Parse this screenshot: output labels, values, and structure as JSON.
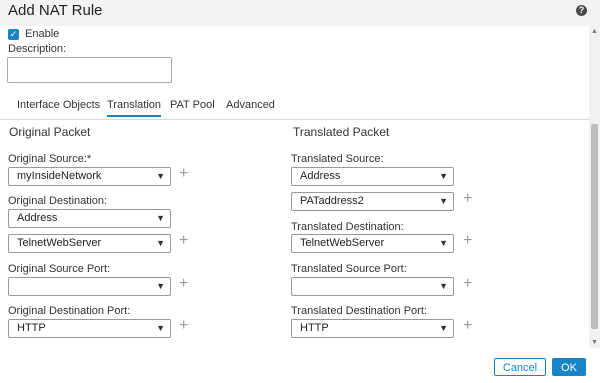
{
  "dialog": {
    "title": "Add NAT Rule",
    "help_icon": "?"
  },
  "enable": {
    "label": "Enable",
    "checked": true
  },
  "description": {
    "label": "Description:",
    "value": ""
  },
  "tabs": [
    {
      "label": "Interface Objects",
      "active": false
    },
    {
      "label": "Translation",
      "active": true
    },
    {
      "label": "PAT Pool",
      "active": false
    },
    {
      "label": "Advanced",
      "active": false
    }
  ],
  "original": {
    "title": "Original Packet",
    "source_label": "Original Source:*",
    "source_value": "myInsideNetwork",
    "destination_label": "Original Destination:",
    "destination_type": "Address",
    "destination_value": "TelnetWebServer",
    "source_port_label": "Original Source Port:",
    "source_port_value": "",
    "destination_port_label": "Original Destination Port:",
    "destination_port_value": "HTTP"
  },
  "translated": {
    "title": "Translated Packet",
    "source_label": "Translated Source:",
    "source_type": "Address",
    "source_value": "PATaddress2",
    "destination_label": "Translated Destination:",
    "destination_value": "TelnetWebServer",
    "source_port_label": "Translated Source Port:",
    "source_port_value": "",
    "destination_port_label": "Translated Destination Port:",
    "destination_port_value": "HTTP"
  },
  "footer": {
    "cancel_label": "Cancel",
    "ok_label": "OK"
  },
  "colors": {
    "accent": "#1a84c6"
  }
}
